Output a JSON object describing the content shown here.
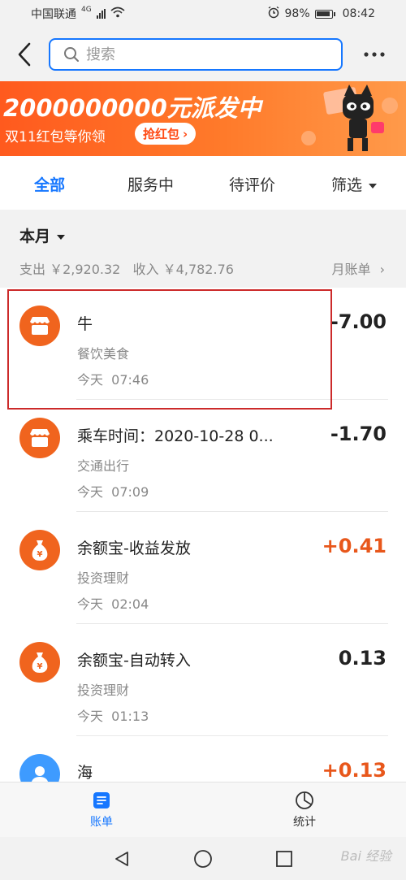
{
  "status_bar": {
    "carrier": "中国联通",
    "network": "4G",
    "battery": "98%",
    "time": "08:42"
  },
  "header": {
    "search_placeholder": "搜索",
    "icons": [
      "back-arrow-icon",
      "search-icon",
      "more-icon"
    ]
  },
  "banner": {
    "title": "2000000000元派发中",
    "subtitle": "双11红包等你领",
    "button": "抢红包"
  },
  "tabs": {
    "all": "全部",
    "in_service": "服务中",
    "to_review": "待评价",
    "filter": "筛选"
  },
  "month": {
    "title": "本月",
    "summary": "支出 ￥2,920.32   收入 ￥4,782.76",
    "monthly_bill": "月账单"
  },
  "transactions": [
    {
      "title": "牛",
      "category": "餐饮美食",
      "time": "今天  07:46",
      "amount": "-7.00",
      "icon": "shop-icon",
      "highlighted": true
    },
    {
      "title": "乘车时间：2020-10-28 0...",
      "category": "交通出行",
      "time": "今天  07:09",
      "amount": "-1.70",
      "icon": "shop-icon"
    },
    {
      "title": "余额宝-收益发放",
      "category": "投资理财",
      "time": "今天  02:04",
      "amount": "+0.41",
      "icon": "money-bag-icon"
    },
    {
      "title": "余额宝-自动转入",
      "category": "投资理财",
      "time": "今天  01:13",
      "amount": "0.13",
      "icon": "money-bag-icon"
    },
    {
      "title": "海",
      "category": "",
      "time": "",
      "amount": "+0.13",
      "icon": "user-avatar-icon"
    }
  ],
  "bottom_nav": {
    "bills": "账单",
    "stats": "统计"
  },
  "watermark": "Bai 经验",
  "colors": {
    "accent": "#1677ff",
    "income": "#e8571b",
    "icon_orange": "#f0641e",
    "highlight_border": "#cc2a2a"
  }
}
